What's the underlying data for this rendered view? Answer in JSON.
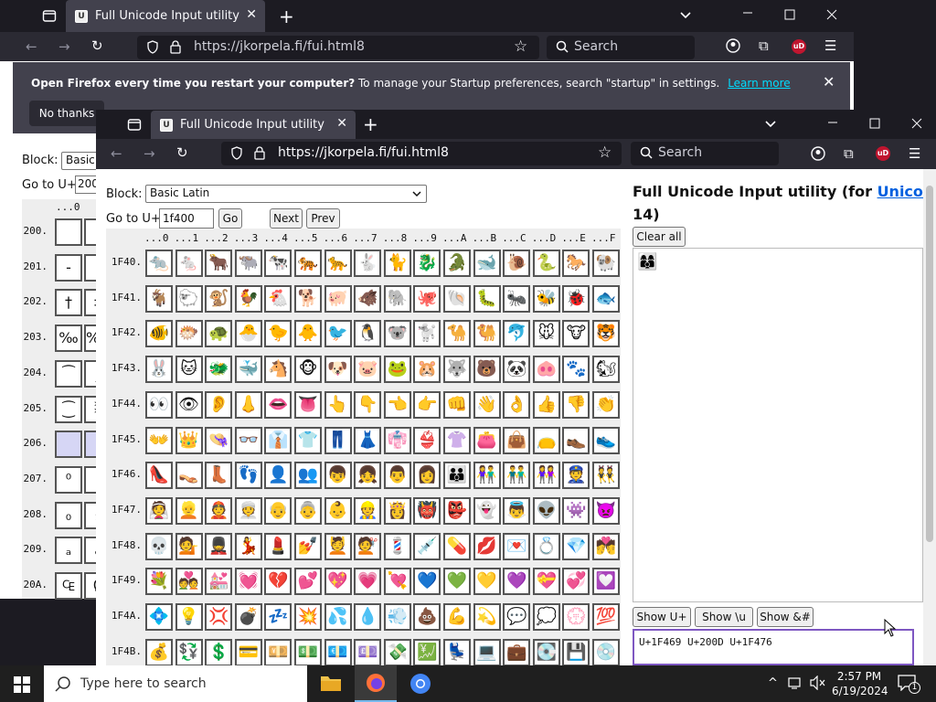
{
  "back_window": {
    "tab_title": "Full Unicode Input utility",
    "tab_close": "✕",
    "new_tab": "+",
    "url": "https://jkorpela.fi/fui.html8",
    "search_placeholder": "Search",
    "notification": {
      "bold": "Open Firefox every time you restart your computer?",
      "text": " To manage your Startup preferences, search \"startup\" in settings.",
      "link": "Learn more",
      "no_thanks": "No thanks",
      "close": "✕"
    },
    "page": {
      "block_label": "Block:",
      "block_value": "Basic",
      "goto_label": "Go to U+",
      "goto_value": "200",
      "col_header": "...0",
      "rows": [
        {
          "label": "200.",
          "a": "",
          "b": ""
        },
        {
          "label": "201.",
          "a": "‐",
          "b": ""
        },
        {
          "label": "202.",
          "a": "†",
          "b": "‡"
        },
        {
          "label": "203.",
          "a": "‰",
          "b": "‱"
        },
        {
          "label": "204.",
          "a": "⁀",
          "b": "⁁"
        },
        {
          "label": "205.",
          "a": "⁐",
          "b": "⁑"
        },
        {
          "label": "206.",
          "a": "",
          "b": ""
        },
        {
          "label": "207.",
          "a": "⁰",
          "b": "ⁱ"
        },
        {
          "label": "208.",
          "a": "₀",
          "b": "₁"
        },
        {
          "label": "209.",
          "a": "ₐ",
          "b": "ₑ"
        },
        {
          "label": "20A.",
          "a": "₠",
          "b": "₡"
        }
      ]
    }
  },
  "front_window": {
    "tab_title": "Full Unicode Input utility",
    "tab_close": "✕",
    "new_tab": "+",
    "url": "https://jkorpela.fi/fui.html8",
    "search_placeholder": "Search",
    "page": {
      "block_label": "Block:",
      "block_value": "Basic Latin",
      "goto_label": "Go to U+",
      "goto_value": "1f400",
      "go_button": "Go",
      "next_button": "Next",
      "prev_button": "Prev",
      "col_headers": [
        "...0",
        "...1",
        "...2",
        "...3",
        "...4",
        "...5",
        "...6",
        "...7",
        "...8",
        "...9",
        "...A",
        "...B",
        "...C",
        "...D",
        "...E",
        "...F"
      ],
      "rows": [
        {
          "label": "1F40.",
          "cells": [
            "🐀",
            "🐁",
            "🐂",
            "🐃",
            "🐄",
            "🐅",
            "🐆",
            "🐇",
            "🐈",
            "🐉",
            "🐊",
            "🐋",
            "🐌",
            "🐍",
            "🐎",
            "🐏"
          ]
        },
        {
          "label": "1F41.",
          "cells": [
            "🐐",
            "🐑",
            "🐒",
            "🐓",
            "🐔",
            "🐕",
            "🐖",
            "🐗",
            "🐘",
            "🐙",
            "🐚",
            "🐛",
            "🐜",
            "🐝",
            "🐞",
            "🐟"
          ]
        },
        {
          "label": "1F42.",
          "cells": [
            "🐠",
            "🐡",
            "🐢",
            "🐣",
            "🐤",
            "🐥",
            "🐦",
            "🐧",
            "🐨",
            "🐩",
            "🐪",
            "🐫",
            "🐬",
            "🐭",
            "🐮",
            "🐯"
          ]
        },
        {
          "label": "1F43.",
          "cells": [
            "🐰",
            "🐱",
            "🐲",
            "🐳",
            "🐴",
            "🐵",
            "🐶",
            "🐷",
            "🐸",
            "🐹",
            "🐺",
            "🐻",
            "🐼",
            "🐽",
            "🐾",
            "🐿"
          ]
        },
        {
          "label": "1F44.",
          "cells": [
            "👀",
            "👁",
            "👂",
            "👃",
            "👄",
            "👅",
            "👆",
            "👇",
            "👈",
            "👉",
            "👊",
            "👋",
            "👌",
            "👍",
            "👎",
            "👏"
          ]
        },
        {
          "label": "1F45.",
          "cells": [
            "👐",
            "👑",
            "👒",
            "👓",
            "👔",
            "👕",
            "👖",
            "👗",
            "👘",
            "👙",
            "👚",
            "👛",
            "👜",
            "👝",
            "👞",
            "👟"
          ]
        },
        {
          "label": "1F46.",
          "cells": [
            "👠",
            "👡",
            "👢",
            "👣",
            "👤",
            "👥",
            "👦",
            "👧",
            "👨",
            "👩",
            "👪",
            "👫",
            "👬",
            "👭",
            "👮",
            "👯"
          ]
        },
        {
          "label": "1F47.",
          "cells": [
            "👰",
            "👱",
            "👲",
            "👳",
            "👴",
            "👵",
            "👶",
            "👷",
            "👸",
            "👹",
            "👺",
            "👻",
            "👼",
            "👽",
            "👾",
            "👿"
          ]
        },
        {
          "label": "1F48.",
          "cells": [
            "💀",
            "💁",
            "💂",
            "💃",
            "💄",
            "💅",
            "💆",
            "💇",
            "💈",
            "💉",
            "💊",
            "💋",
            "💌",
            "💍",
            "💎",
            "💏"
          ]
        },
        {
          "label": "1F49.",
          "cells": [
            "💐",
            "💑",
            "💒",
            "💓",
            "💔",
            "💕",
            "💖",
            "💗",
            "💘",
            "💙",
            "💚",
            "💛",
            "💜",
            "💝",
            "💞",
            "💟"
          ]
        },
        {
          "label": "1F4A.",
          "cells": [
            "💠",
            "💡",
            "💢",
            "💣",
            "💤",
            "💥",
            "💦",
            "💧",
            "💨",
            "💩",
            "💪",
            "💫",
            "💬",
            "💭",
            "💮",
            "💯"
          ]
        },
        {
          "label": "1F4B.",
          "cells": [
            "💰",
            "💱",
            "💲",
            "💳",
            "💴",
            "💵",
            "💶",
            "💷",
            "💸",
            "💹",
            "💺",
            "💻",
            "💼",
            "💽",
            "💾",
            "💿"
          ]
        }
      ],
      "title_prefix": "Full Unicode Input utility (for ",
      "title_link": "Unicode ve",
      "title_line2": "14)",
      "clear_all": "Clear all",
      "selected_char": "👩‍👩‍👦",
      "show_u": "Show U+",
      "show_backslash": "Show \\u",
      "show_amp": "Show &#",
      "output_text": "U+1F469 U+200D U+1F476"
    }
  },
  "taskbar": {
    "search_placeholder": "Type here to search",
    "time": "2:57 PM",
    "date": "6/19/2024",
    "notification_count": "1"
  }
}
